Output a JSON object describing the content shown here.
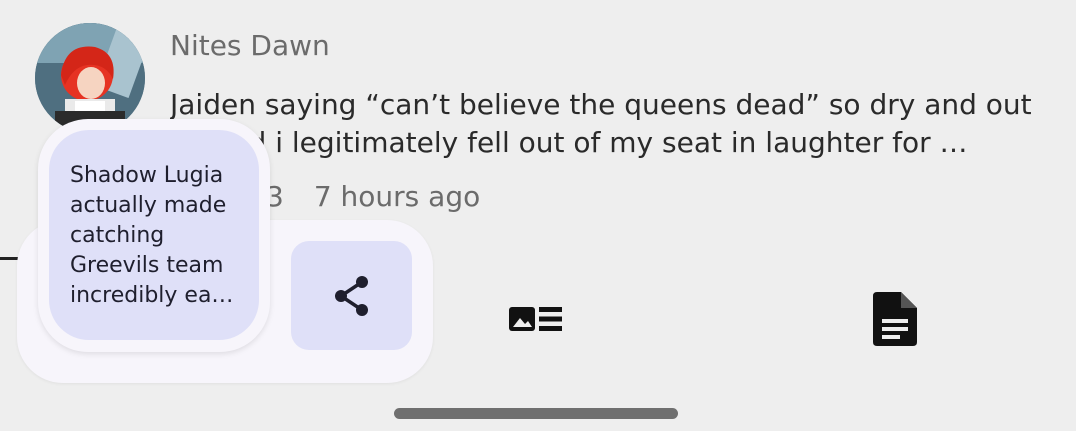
{
  "post": {
    "author": "Nites Dawn",
    "text": "Jaiden saying “can’t believe the queens dead” so dry and out of field i legitimately fell out of my seat in laughter for …",
    "likes": "3",
    "time": "7 hours ago"
  },
  "tooltip": {
    "text": "Shadow Lugia actually made catching Greevils team incredibly ea…"
  },
  "icons": {
    "avatar": "avatar-image",
    "share": "share-icon",
    "article": "article-icon",
    "document": "document-icon"
  },
  "colors": {
    "background": "#eeeeee",
    "panel": "#f7f5fb",
    "accent_container": "#dfe0f8",
    "text_primary": "#2a2a2a",
    "text_secondary": "#6b6b6b"
  }
}
